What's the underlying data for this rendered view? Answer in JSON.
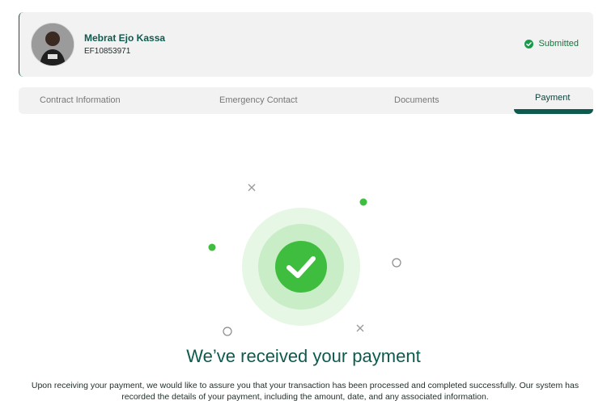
{
  "profile": {
    "name": "Mebrat Ejo Kassa",
    "employee_id": "EF10853971",
    "status": "Submitted"
  },
  "tabs": [
    {
      "label": "Contract Information"
    },
    {
      "label": "Emergency Contact"
    },
    {
      "label": "Documents"
    },
    {
      "label": "Payment"
    }
  ],
  "confirmation": {
    "title": "We’ve received your payment",
    "message": "Upon receiving your payment, we would like to assure you that your transaction has been processed and completed successfully. Our system has recorded the details of your payment, including the amount, date, and any associated information."
  },
  "colors": {
    "brand": "#0e5a4e",
    "success": "#3ebd3e",
    "success_light": "#c9edc6",
    "success_pale": "#e7f7e5"
  },
  "icons": [
    "avatar-photo",
    "check-circle-icon",
    "success-check-icon",
    "close-icon",
    "circle-outline-icon",
    "dot-icon"
  ]
}
